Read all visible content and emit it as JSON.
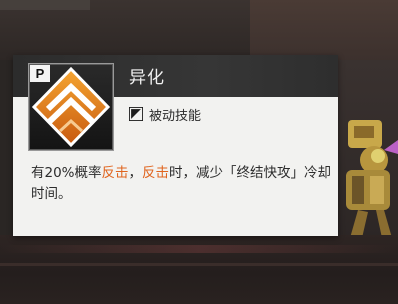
{
  "skill": {
    "name": "异化",
    "badge": "P",
    "type_label": "被动技能",
    "icon": "chevron-rank-icon"
  },
  "description": {
    "parts": [
      {
        "text": "有20%概率",
        "highlight": false
      },
      {
        "text": "反击",
        "highlight": true
      },
      {
        "text": "，",
        "highlight": false
      },
      {
        "text": "反击",
        "highlight": true
      },
      {
        "text": "时，减少「终结快攻」冷却时间。",
        "highlight": false
      }
    ]
  },
  "colors": {
    "highlight": "#e0641e",
    "icon_orange": "#e07a1c",
    "header_bg": "#2c2c2c",
    "card_bg": "#f2f2f0"
  }
}
